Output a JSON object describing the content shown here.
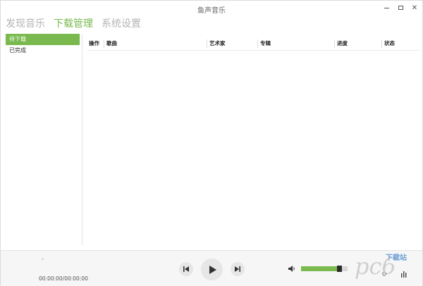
{
  "app": {
    "title": "鱼声音乐"
  },
  "main_tabs": [
    {
      "label": "发现音乐",
      "active": false
    },
    {
      "label": "下载管理",
      "active": true
    },
    {
      "label": "系统设置",
      "active": false
    }
  ],
  "sidebar": {
    "items": [
      {
        "label": "待下载",
        "active": true
      },
      {
        "label": "已完成",
        "active": false
      }
    ]
  },
  "table": {
    "columns": [
      "操作",
      "歌曲",
      "艺术家",
      "专辑",
      "进度",
      "状态"
    ],
    "rows": []
  },
  "player": {
    "track_name": "-",
    "time": "00:00:00/00:00:00",
    "volume_level": 0.82
  },
  "watermark": {
    "text": "下载站"
  },
  "colors": {
    "accent": "#79b94d",
    "inactive_tab": "#b4b4b4"
  }
}
